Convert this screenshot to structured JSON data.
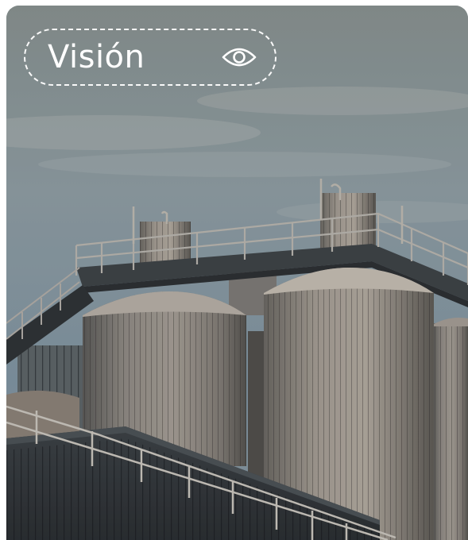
{
  "card": {
    "title": "Visión",
    "icon": "eye-icon",
    "image_subject": "industrial-silos"
  },
  "colors": {
    "badge_text": "#ffffff",
    "badge_border": "#ffffff"
  }
}
